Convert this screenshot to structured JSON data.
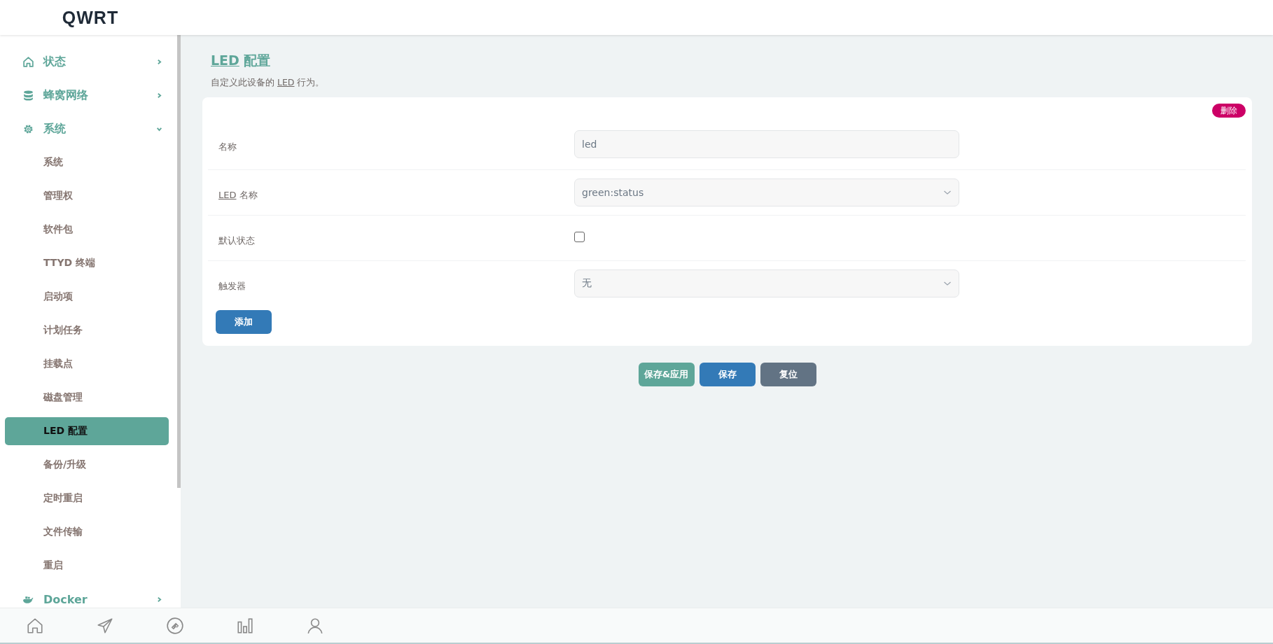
{
  "header": {
    "logo": "QWRT"
  },
  "sidebar": {
    "items": [
      {
        "label": "状态",
        "expanded": false
      },
      {
        "label": "蜂窝网络",
        "expanded": false
      },
      {
        "label": "系统",
        "expanded": true,
        "children": [
          {
            "label": "系统",
            "selected": false
          },
          {
            "label": "管理权",
            "selected": false
          },
          {
            "label": "软件包",
            "selected": false
          },
          {
            "label": "TTYD 终端",
            "selected": false
          },
          {
            "label": "启动项",
            "selected": false
          },
          {
            "label": "计划任务",
            "selected": false
          },
          {
            "label": "挂载点",
            "selected": false
          },
          {
            "label": "磁盘管理",
            "selected": false
          },
          {
            "label": "LED 配置",
            "selected": true
          },
          {
            "label": "备份/升级",
            "selected": false
          },
          {
            "label": "定时重启",
            "selected": false
          },
          {
            "label": "文件传输",
            "selected": false
          },
          {
            "label": "重启",
            "selected": false
          }
        ]
      },
      {
        "label": "Docker",
        "expanded": false
      }
    ]
  },
  "page": {
    "title_abbr": "LED",
    "title": "配置",
    "description_before": "自定义此设备的",
    "description_abbr": "LED",
    "description_after": "行为。"
  },
  "card": {
    "delete_button": "删除",
    "rows": [
      {
        "kind": "text",
        "label": "名称",
        "value": "led"
      },
      {
        "kind": "select",
        "label_abbr": "LED",
        "label": "名称",
        "value": "green:status"
      },
      {
        "kind": "checkbox",
        "label": "默认状态",
        "checked": false
      },
      {
        "kind": "select",
        "label": "触发器",
        "value": "无"
      }
    ],
    "add_button": "添加"
  },
  "actions": [
    {
      "label": "保存&应用",
      "kind": "apply"
    },
    {
      "label": "保存",
      "kind": "save"
    },
    {
      "label": "复位",
      "kind": "reset"
    }
  ]
}
